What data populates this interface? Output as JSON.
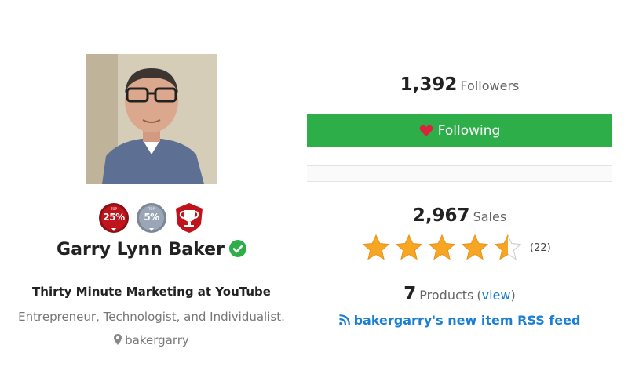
{
  "profile": {
    "name": "Garry Lynn Baker",
    "company": "Thirty Minute Marketing at YouTube",
    "tagline": "Entrepreneur, Technologist, and Individualist.",
    "username": "bakergarry"
  },
  "badges": [
    {
      "top": "TOP",
      "value": "25%",
      "color": "#c0141c"
    },
    {
      "top": "TOP",
      "value": "5%",
      "color": "#9aa5b5"
    },
    {
      "icon": "trophy-icon",
      "color": "#c0141c"
    }
  ],
  "followers": {
    "count": "1,392",
    "label": "Followers"
  },
  "follow_button": {
    "label": "Following",
    "color": "#2eae49"
  },
  "sales": {
    "count": "2,967",
    "label": "Sales"
  },
  "rating": {
    "stars": 4.5,
    "max": 5,
    "reviews": "(22)",
    "star_color": "#f6a623"
  },
  "products": {
    "count": "7",
    "label": "Products",
    "open_paren": "(",
    "link": "view",
    "close_paren": ")"
  },
  "rss": {
    "label": "bakergarry's new item RSS feed",
    "color": "#1a7fd4"
  }
}
